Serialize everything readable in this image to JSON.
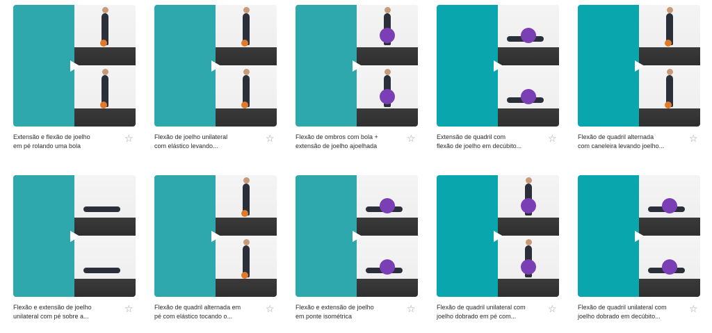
{
  "icons": {
    "favorite": "star-outline-icon",
    "play": "play-icon"
  },
  "colors": {
    "accent": "#2ea7ad",
    "accent_alt": "#0aa6ad",
    "text": "#2b2b2b",
    "star": "#9aa0a6"
  },
  "exercises": [
    {
      "title_line1": "Extensão e flexão de joelho",
      "title_line2": "em pé rolando uma bola"
    },
    {
      "title_line1": "Flexão de joelho unilateral",
      "title_line2": "com elástico levando..."
    },
    {
      "title_line1": "Flexão de ombros com bola +",
      "title_line2": "extensão de joelho ajoelhada"
    },
    {
      "title_line1": "Extensão de quadril com",
      "title_line2": "flexão de joelho em decúbito..."
    },
    {
      "title_line1": "Flexão de quadril alternada",
      "title_line2": "com caneleira levando joelho..."
    },
    {
      "title_line1": "Flexão e extensão de joelho",
      "title_line2": "unilateral com pé sobre a..."
    },
    {
      "title_line1": "Flexão de quadril alternada em",
      "title_line2": "pé com elástico tocando o..."
    },
    {
      "title_line1": "Flexão e extensão de joelho",
      "title_line2": "em ponte isométrica"
    },
    {
      "title_line1": "Flexão de quadril unilateral com",
      "title_line2": "joelho dobrado em pé com..."
    },
    {
      "title_line1": "Flexão de quadril unilateral com",
      "title_line2": "joelho dobrado em decúbito..."
    }
  ]
}
